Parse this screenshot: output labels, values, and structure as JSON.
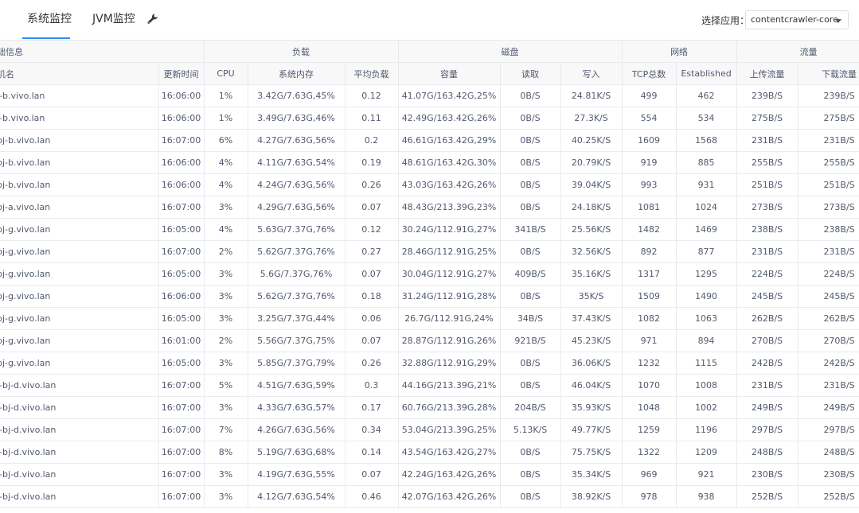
{
  "tabs": [
    {
      "label": "系统监控",
      "active": true
    },
    {
      "label": "JVM监控",
      "active": false
    }
  ],
  "toolbar": {
    "icon": "wrench-icon"
  },
  "app_selector": {
    "label": "选择应用：",
    "value": "contentcrawler-core"
  },
  "table": {
    "groups": [
      "础信息",
      "负载",
      "磁盘",
      "网络",
      "流量"
    ],
    "columns": [
      "机名",
      "更新时间",
      "CPU",
      "系统内存",
      "平均负载",
      "容量",
      "读取",
      "写入",
      "TCP总数",
      "Established",
      "上传流量",
      "下载流量"
    ],
    "rows": [
      [
        "j-b.vivo.lan",
        "16:06:00",
        "1%",
        "3.42G/7.63G,45%",
        "0.12",
        "41.07G/163.42G,25%",
        "0B/S",
        "24.81K/S",
        "499",
        "462",
        "239B/S",
        "239B/S"
      ],
      [
        "j-b.vivo.lan",
        "16:06:00",
        "1%",
        "3.49G/7.63G,46%",
        "0.11",
        "42.49G/163.42G,26%",
        "0B/S",
        "27.3K/S",
        "554",
        "534",
        "275B/S",
        "275B/S"
      ],
      [
        "bj-b.vivo.lan",
        "16:07:00",
        "6%",
        "4.27G/7.63G,56%",
        "0.2",
        "46.61G/163.42G,29%",
        "0B/S",
        "40.25K/S",
        "1609",
        "1568",
        "231B/S",
        "231B/S"
      ],
      [
        "bj-b.vivo.lan",
        "16:06:00",
        "4%",
        "4.11G/7.63G,54%",
        "0.19",
        "48.61G/163.42G,30%",
        "0B/S",
        "20.79K/S",
        "919",
        "885",
        "255B/S",
        "255B/S"
      ],
      [
        "bj-b.vivo.lan",
        "16:06:00",
        "4%",
        "4.24G/7.63G,56%",
        "0.26",
        "43.03G/163.42G,26%",
        "0B/S",
        "39.04K/S",
        "993",
        "931",
        "251B/S",
        "251B/S"
      ],
      [
        "bj-a.vivo.lan",
        "16:07:00",
        "3%",
        "4.29G/7.63G,56%",
        "0.07",
        "48.43G/213.39G,23%",
        "0B/S",
        "24.18K/S",
        "1081",
        "1024",
        "273B/S",
        "273B/S"
      ],
      [
        "bj-g.vivo.lan",
        "16:05:00",
        "4%",
        "5.63G/7.37G,76%",
        "0.12",
        "30.24G/112.91G,27%",
        "341B/S",
        "25.56K/S",
        "1482",
        "1469",
        "238B/S",
        "238B/S"
      ],
      [
        "bj-g.vivo.lan",
        "16:07:00",
        "2%",
        "5.62G/7.37G,76%",
        "0.27",
        "28.46G/112.91G,25%",
        "0B/S",
        "32.56K/S",
        "892",
        "877",
        "231B/S",
        "231B/S"
      ],
      [
        "bj-g.vivo.lan",
        "16:05:00",
        "3%",
        "5.6G/7.37G,76%",
        "0.07",
        "30.04G/112.91G,27%",
        "409B/S",
        "35.16K/S",
        "1317",
        "1295",
        "224B/S",
        "224B/S"
      ],
      [
        "bj-g.vivo.lan",
        "16:06:00",
        "3%",
        "5.62G/7.37G,76%",
        "0.18",
        "31.24G/112.91G,28%",
        "0B/S",
        "35K/S",
        "1509",
        "1490",
        "245B/S",
        "245B/S"
      ],
      [
        "bj-g.vivo.lan",
        "16:05:00",
        "3%",
        "3.25G/7.37G,44%",
        "0.06",
        "26.7G/112.91G,24%",
        "34B/S",
        "37.43K/S",
        "1082",
        "1063",
        "262B/S",
        "262B/S"
      ],
      [
        "bj-g.vivo.lan",
        "16:01:00",
        "2%",
        "5.56G/7.37G,75%",
        "0.07",
        "28.87G/112.91G,26%",
        "921B/S",
        "45.23K/S",
        "971",
        "894",
        "270B/S",
        "270B/S"
      ],
      [
        "bj-g.vivo.lan",
        "16:05:00",
        "3%",
        "5.85G/7.37G,79%",
        "0.26",
        "32.88G/112.91G,29%",
        "0B/S",
        "36.06K/S",
        "1232",
        "1115",
        "242B/S",
        "242B/S"
      ],
      [
        "i-bj-d.vivo.lan",
        "16:07:00",
        "5%",
        "4.51G/7.63G,59%",
        "0.3",
        "44.16G/213.39G,21%",
        "0B/S",
        "46.04K/S",
        "1070",
        "1008",
        "231B/S",
        "231B/S"
      ],
      [
        "i-bj-d.vivo.lan",
        "16:07:00",
        "3%",
        "4.33G/7.63G,57%",
        "0.17",
        "60.76G/213.39G,28%",
        "204B/S",
        "35.93K/S",
        "1048",
        "1002",
        "249B/S",
        "249B/S"
      ],
      [
        "i-bj-d.vivo.lan",
        "16:07:00",
        "7%",
        "4.26G/7.63G,56%",
        "0.34",
        "53.04G/213.39G,25%",
        "5.13K/S",
        "49.77K/S",
        "1259",
        "1196",
        "297B/S",
        "297B/S"
      ],
      [
        "i-bj-d.vivo.lan",
        "16:07:00",
        "8%",
        "5.19G/7.63G,68%",
        "0.14",
        "43.54G/163.42G,27%",
        "0B/S",
        "75.75K/S",
        "1322",
        "1209",
        "248B/S",
        "248B/S"
      ],
      [
        "i-bj-d.vivo.lan",
        "16:07:00",
        "3%",
        "4.19G/7.63G,55%",
        "0.07",
        "42.24G/163.42G,26%",
        "0B/S",
        "35.34K/S",
        "969",
        "921",
        "230B/S",
        "230B/S"
      ],
      [
        "i-bj-d.vivo.lan",
        "16:07:00",
        "3%",
        "4.12G/7.63G,54%",
        "0.46",
        "42.07G/163.42G,26%",
        "0B/S",
        "38.92K/S",
        "978",
        "938",
        "252B/S",
        "252B/S"
      ]
    ]
  }
}
